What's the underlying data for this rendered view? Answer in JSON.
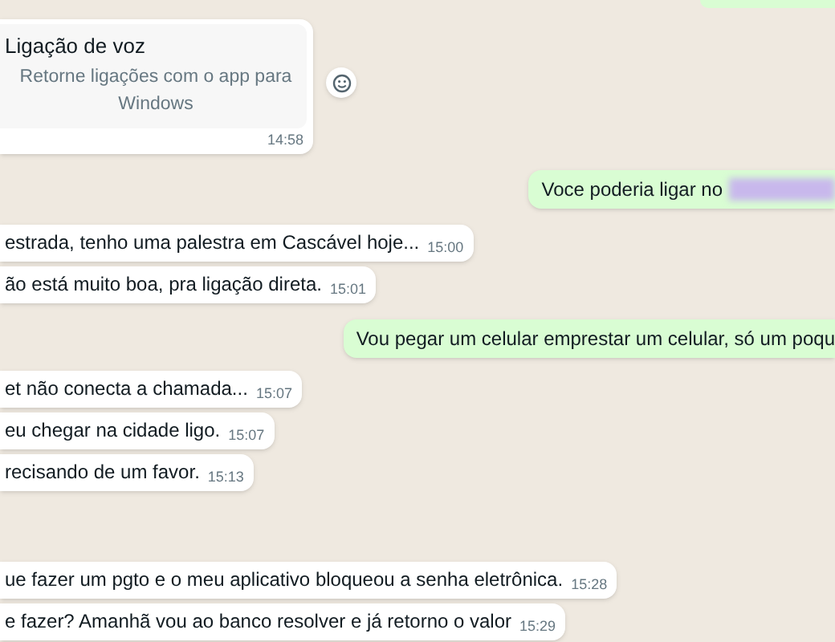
{
  "groups": [
    {
      "kind": "incoming",
      "messages": [
        {
          "kind": "call",
          "title": "Ligação de voz",
          "subtitle": "Retorne ligações com o app para Windows",
          "time": "14:58"
        }
      ]
    },
    {
      "kind": "outgoing",
      "messages": [
        {
          "kind": "text",
          "text": "Voce poderia ligar no",
          "redacted": true
        }
      ]
    },
    {
      "kind": "incoming",
      "messages": [
        {
          "kind": "text",
          "text": "estrada, tenho uma palestra em Cascável hoje...",
          "time": "15:00"
        },
        {
          "kind": "text",
          "text": "ão está muito boa, pra ligação direta.",
          "time": "15:01"
        }
      ]
    },
    {
      "kind": "outgoing",
      "messages": [
        {
          "kind": "text",
          "text": "Vou pegar um celular emprestar um celular, só um poqu",
          "redacted": false
        }
      ]
    },
    {
      "kind": "incoming",
      "messages": [
        {
          "kind": "text",
          "text": "et não conecta a chamada...",
          "time": "15:07"
        },
        {
          "kind": "text",
          "text": "eu chegar na cidade ligo.",
          "time": "15:07"
        },
        {
          "kind": "text",
          "text": "recisando de um favor.",
          "time": "15:13"
        }
      ]
    },
    {
      "kind": "incoming",
      "messages": [
        {
          "kind": "text",
          "text": "ue fazer um pgto e o meu aplicativo bloqueou a senha eletrônica.",
          "time": "15:28"
        },
        {
          "kind": "text",
          "text": "e fazer? Amanhã vou ao banco resolver e já retorno o valor",
          "time": "15:29"
        }
      ]
    }
  ]
}
